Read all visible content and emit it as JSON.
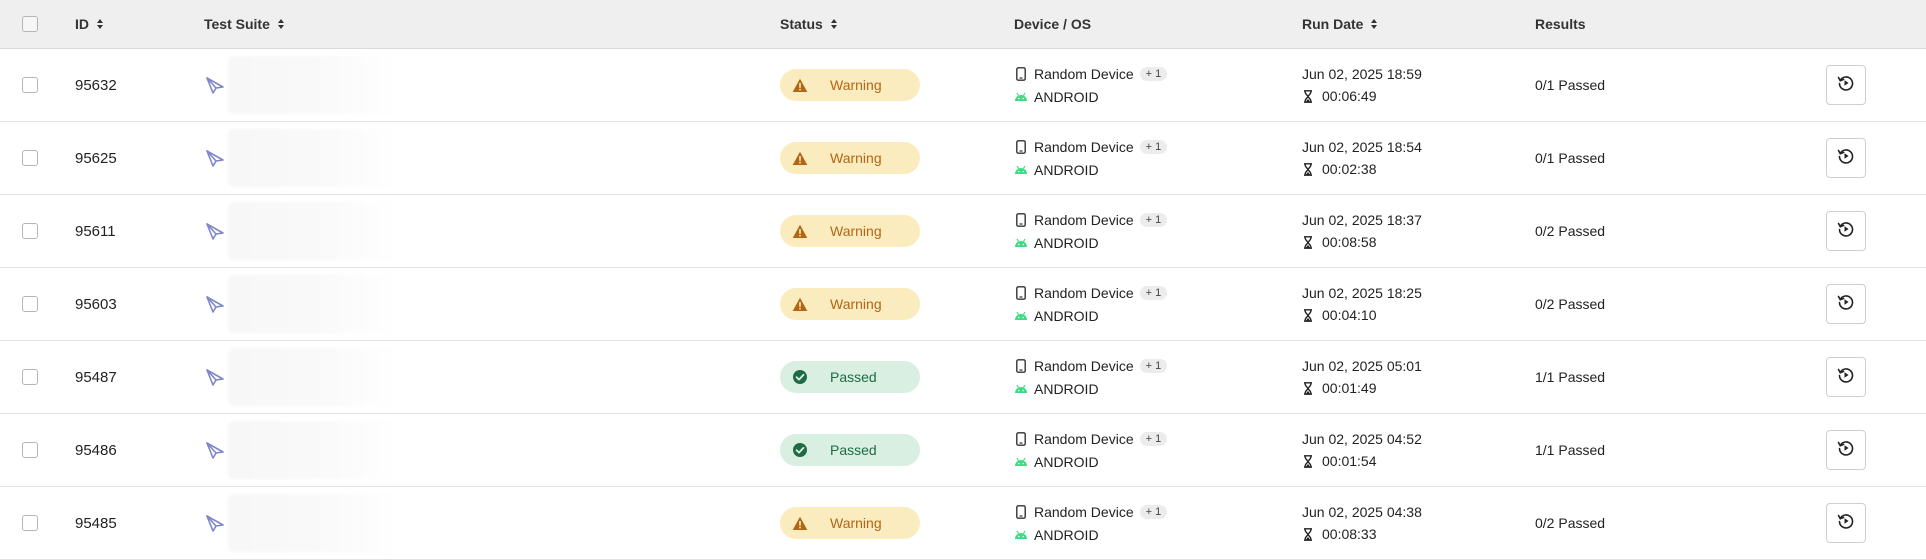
{
  "columns": {
    "id": "ID",
    "test_suite": "Test Suite",
    "status": "Status",
    "device_os": "Device / OS",
    "run_date": "Run Date",
    "results": "Results"
  },
  "colors": {
    "warning_bg": "#fbecc0",
    "warning_text": "#b26613",
    "passed_bg": "#d8efe2",
    "passed_text": "#1f6b45",
    "android_green": "#3ddc84",
    "suite_icon": "#7f86c9"
  },
  "rows": [
    {
      "id": "95632",
      "status": "Warning",
      "device": "Random Device",
      "device_extra": "+ 1",
      "os": "ANDROID",
      "date": "Jun 02, 2025 18:59",
      "duration": "00:06:49",
      "results": "0/1 Passed"
    },
    {
      "id": "95625",
      "status": "Warning",
      "device": "Random Device",
      "device_extra": "+ 1",
      "os": "ANDROID",
      "date": "Jun 02, 2025 18:54",
      "duration": "00:02:38",
      "results": "0/1 Passed"
    },
    {
      "id": "95611",
      "status": "Warning",
      "device": "Random Device",
      "device_extra": "+ 1",
      "os": "ANDROID",
      "date": "Jun 02, 2025 18:37",
      "duration": "00:08:58",
      "results": "0/2 Passed"
    },
    {
      "id": "95603",
      "status": "Warning",
      "device": "Random Device",
      "device_extra": "+ 1",
      "os": "ANDROID",
      "date": "Jun 02, 2025 18:25",
      "duration": "00:04:10",
      "results": "0/2 Passed"
    },
    {
      "id": "95487",
      "status": "Passed",
      "device": "Random Device",
      "device_extra": "+ 1",
      "os": "ANDROID",
      "date": "Jun 02, 2025 05:01",
      "duration": "00:01:49",
      "results": "1/1 Passed"
    },
    {
      "id": "95486",
      "status": "Passed",
      "device": "Random Device",
      "device_extra": "+ 1",
      "os": "ANDROID",
      "date": "Jun 02, 2025 04:52",
      "duration": "00:01:54",
      "results": "1/1 Passed"
    },
    {
      "id": "95485",
      "status": "Warning",
      "device": "Random Device",
      "device_extra": "+ 1",
      "os": "ANDROID",
      "date": "Jun 02, 2025 04:38",
      "duration": "00:08:33",
      "results": "0/2 Passed"
    }
  ]
}
